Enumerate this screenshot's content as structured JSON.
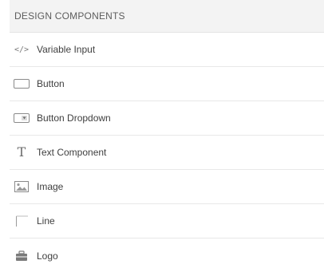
{
  "panel": {
    "title": "DESIGN COMPONENTS"
  },
  "components": [
    {
      "label": "Variable Input",
      "icon": "code-icon"
    },
    {
      "label": "Button",
      "icon": "button-icon"
    },
    {
      "label": "Button Dropdown",
      "icon": "button-dropdown-icon"
    },
    {
      "label": "Text Component",
      "icon": "text-icon"
    },
    {
      "label": "Image",
      "icon": "image-icon"
    },
    {
      "label": "Line",
      "icon": "line-icon"
    },
    {
      "label": "Logo",
      "icon": "logo-icon"
    }
  ],
  "icon_glyphs": {
    "code": "</>",
    "text": "T"
  },
  "colors": {
    "header_bg": "#f3f3f3",
    "divider": "#e8e8e8",
    "text": "#3f3f3f",
    "icon": "#7a7a7a"
  }
}
